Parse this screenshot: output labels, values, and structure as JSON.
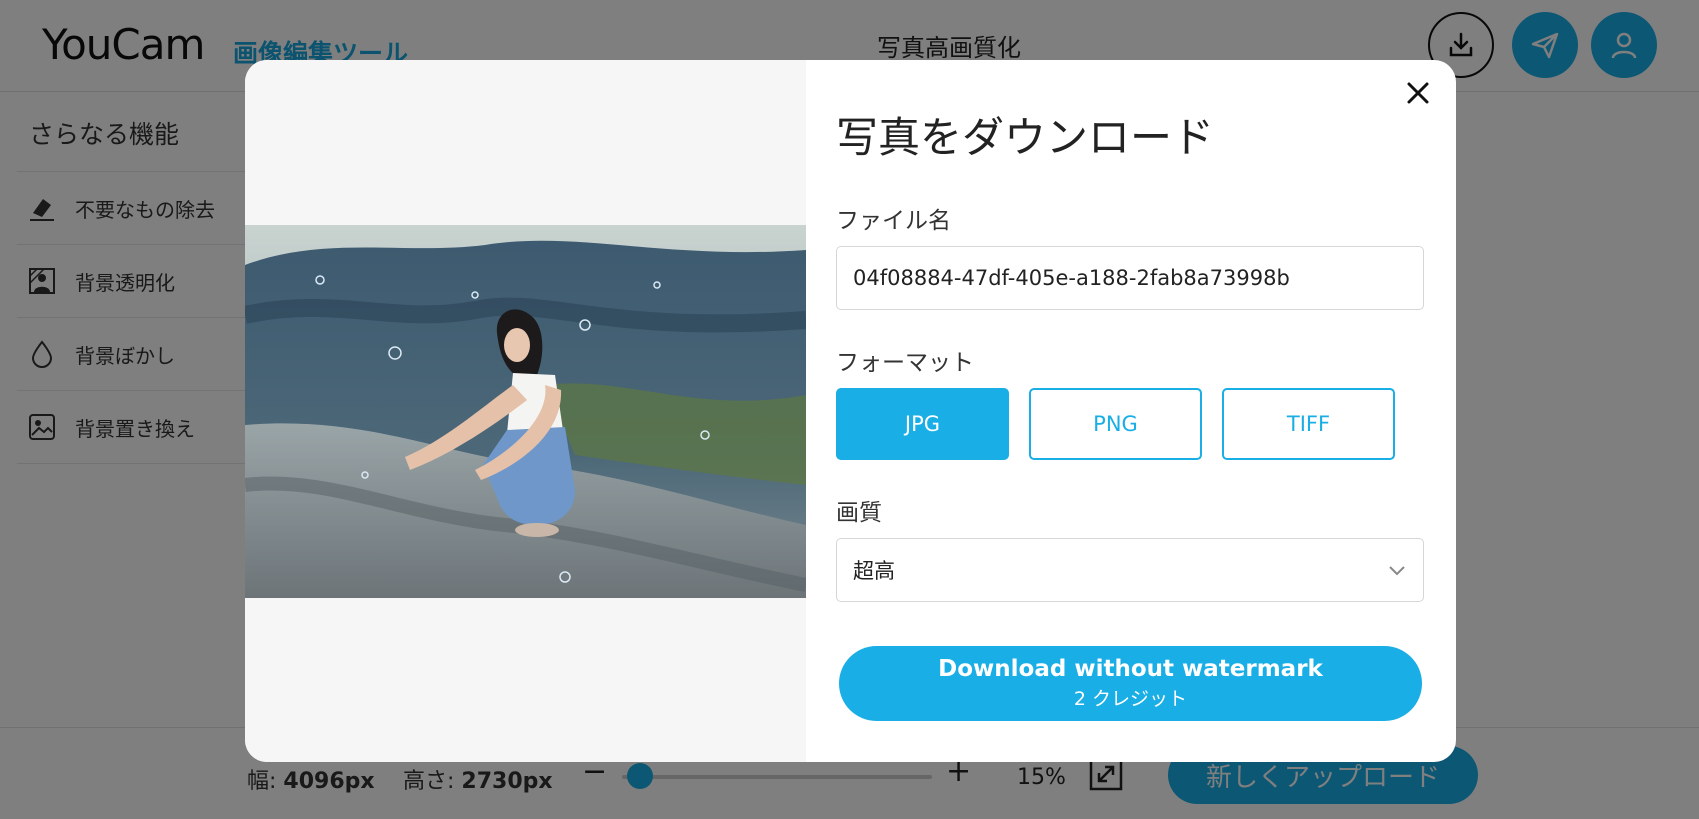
{
  "header": {
    "logo": "YouCam",
    "logo_sub": "画像編集ツール",
    "page_title": "写真高画質化"
  },
  "sidebar": {
    "title": "さらなる機能",
    "items": [
      {
        "label": "不要なもの除去",
        "icon": "eraser-icon"
      },
      {
        "label": "背景透明化",
        "icon": "transparent-background-icon"
      },
      {
        "label": "背景ぼかし",
        "icon": "drop-icon"
      },
      {
        "label": "背景置き換え",
        "icon": "image-replace-icon"
      }
    ]
  },
  "bottombar": {
    "width_label": "幅:",
    "width_value": "4096px",
    "height_label": "高さ:",
    "height_value": "2730px",
    "zoom_minus": "−",
    "zoom_plus": "+",
    "zoom_percent": "15%",
    "zoom_fraction": 0.15,
    "upload_label": "新しくアップロード"
  },
  "modal": {
    "title": "写真をダウンロード",
    "filename_label": "ファイル名",
    "filename_value": "04f08884-47df-405e-a188-2fab8a73998b",
    "format_label": "フォーマット",
    "formats": [
      "JPG",
      "PNG",
      "TIFF"
    ],
    "selected_format": "JPG",
    "quality_label": "画質",
    "quality_value": "超高",
    "download_label": "Download without watermark",
    "download_sub": "2 クレジット"
  },
  "colors": {
    "accent": "#19aee6",
    "overlay": "rgba(0,0,0,0.5)"
  }
}
